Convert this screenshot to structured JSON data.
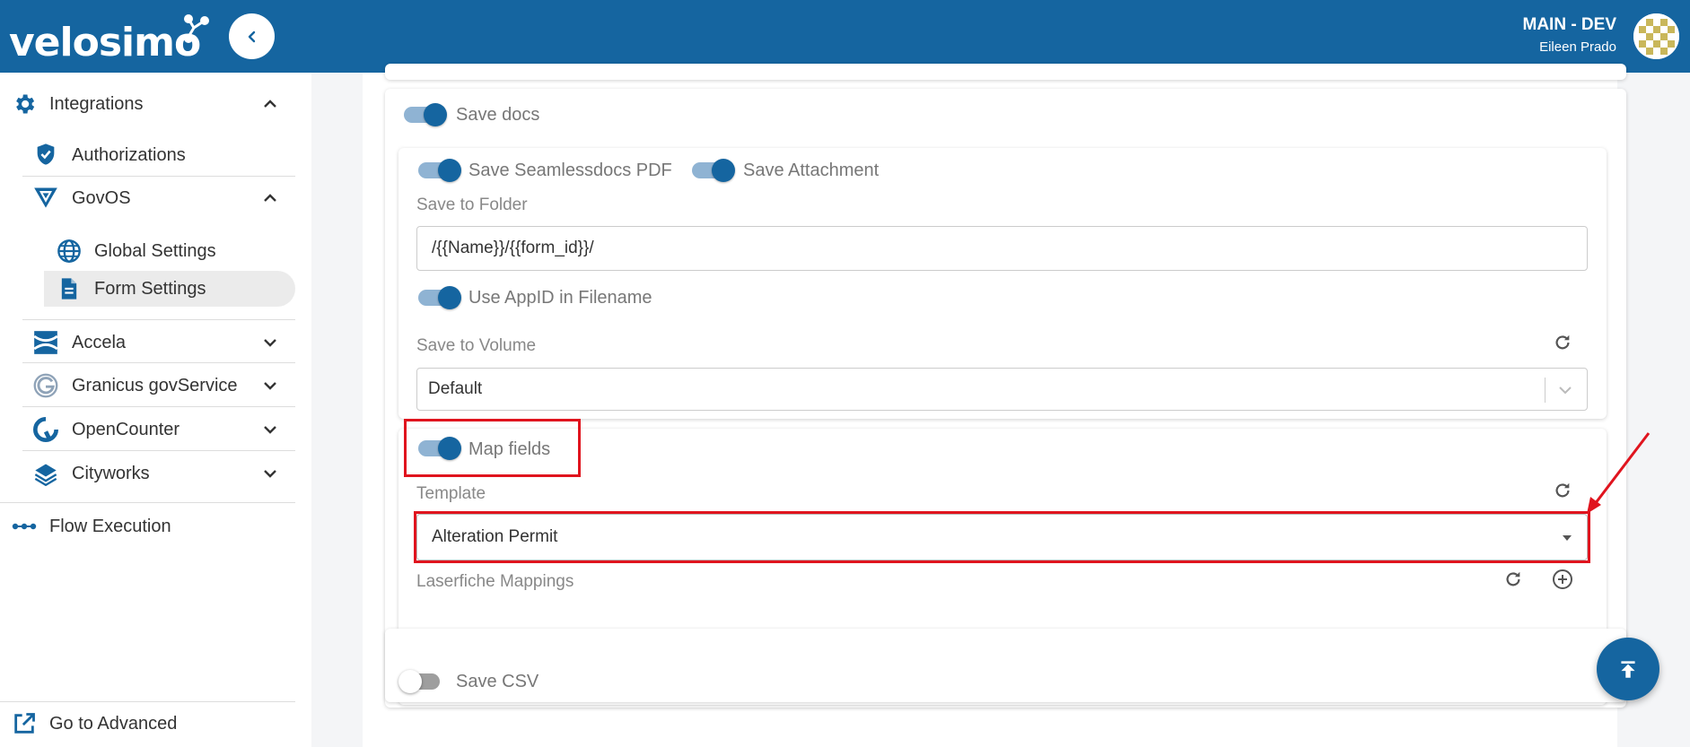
{
  "header": {
    "logo_text": "velosimo",
    "environment": "MAIN - DEV",
    "user_name": "Eileen Prado"
  },
  "sidebar": {
    "integrations_label": "Integrations",
    "items": [
      {
        "label": "Authorizations"
      },
      {
        "label": "GovOS"
      },
      {
        "label": "Global Settings"
      },
      {
        "label": "Form Settings"
      },
      {
        "label": "Accela"
      },
      {
        "label": "Granicus govService"
      },
      {
        "label": "OpenCounter"
      },
      {
        "label": "Cityworks"
      }
    ],
    "flow_execution_label": "Flow Execution",
    "go_advanced_label": "Go to Advanced"
  },
  "form": {
    "save_docs_label": "Save docs",
    "save_seamless_pdf_label": "Save Seamlessdocs PDF",
    "save_attachment_label": "Save Attachment",
    "save_to_folder_label": "Save to Folder",
    "save_to_folder_value": "/{{Name}}/{{form_id}}/",
    "use_appid_label": "Use AppID in Filename",
    "save_to_volume_label": "Save to Volume",
    "save_to_volume_value": "Default",
    "map_fields_label": "Map fields",
    "template_label": "Template",
    "template_value": "Alteration Permit",
    "laserfiche_label": "Laserfiche Mappings",
    "save_csv_label": "Save CSV"
  },
  "colors": {
    "brand": "#1565a0",
    "highlight": "#e0141e"
  }
}
